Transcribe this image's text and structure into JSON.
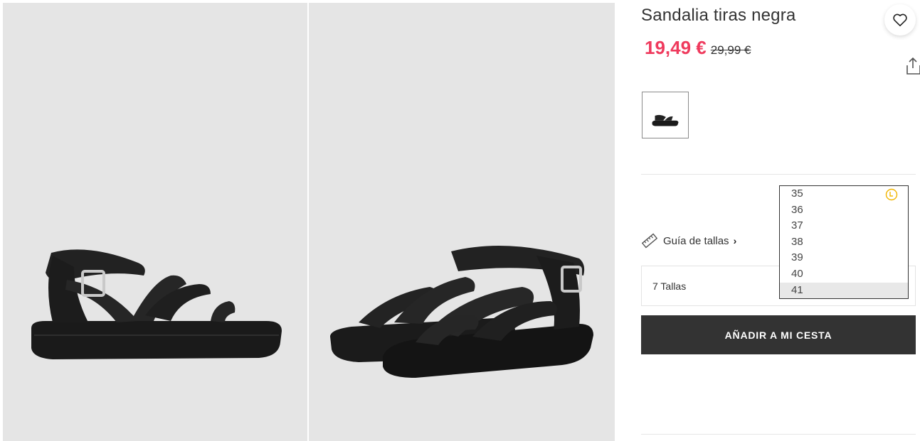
{
  "product": {
    "title": "Sandalia tiras negra",
    "price_current": "19,49 €",
    "price_old": "29,99 €"
  },
  "gallery": {
    "images": [
      {
        "alt": "sandal-side-view"
      },
      {
        "alt": "sandal-pair-view"
      }
    ]
  },
  "size_guide": {
    "label": "Guía de tallas",
    "chevron": "›"
  },
  "size_select": {
    "label": "7 Tallas"
  },
  "size_dropdown": {
    "options": [
      "35",
      "36",
      "37",
      "38",
      "39",
      "40",
      "41"
    ],
    "selected": "41",
    "low_stock_icon": "clock-icon"
  },
  "cart": {
    "button_label": "AÑADIR A MI CESTA"
  },
  "colors": {
    "price_accent": "#ef3a5d",
    "button_bg": "#333333",
    "clock_accent": "#f1b500",
    "image_bg": "#e5e5e5"
  }
}
